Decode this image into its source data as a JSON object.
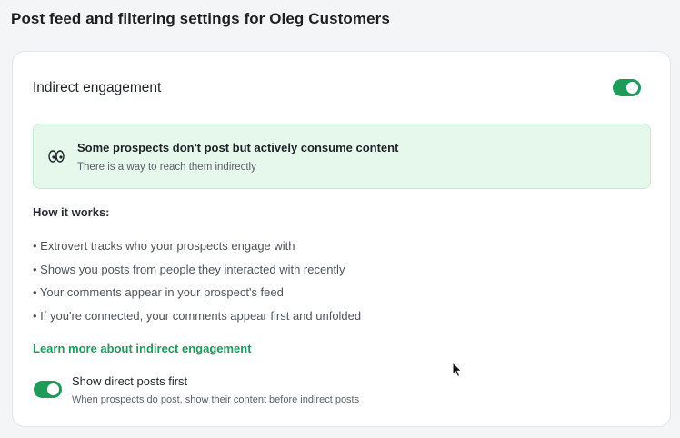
{
  "page": {
    "title": "Post feed and filtering settings for Oleg Customers"
  },
  "indirect": {
    "title": "Indirect engagement",
    "enabled": true
  },
  "info": {
    "icon": "eyes-icon",
    "title": "Some prospects don't post but actively consume content",
    "subtitle": "There is a way to reach them indirectly"
  },
  "how": {
    "title": "How it works:",
    "items": [
      "• Extrovert tracks who your prospects engage with",
      "• Shows you posts from people they interacted with recently",
      "• Your comments appear in your prospect's feed",
      "• If you're connected, your comments appear first and unfolded"
    ]
  },
  "learn_more": {
    "label": "Learn more about indirect engagement"
  },
  "direct_first": {
    "title": "Show direct posts first",
    "subtitle": "When prospects do post, show their content before indirect posts",
    "enabled": true
  },
  "colors": {
    "accent": "#1f9a5b",
    "info_bg": "#e6f7ec"
  }
}
